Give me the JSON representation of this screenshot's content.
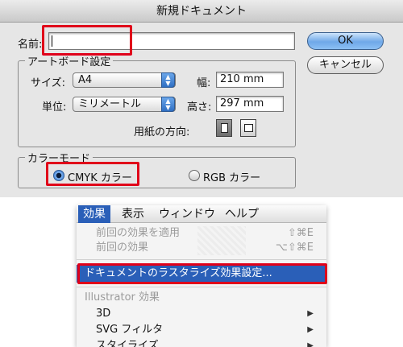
{
  "dialog": {
    "title": "新規ドキュメント",
    "name_label": "名前:",
    "name_value": "",
    "ok_label": "OK",
    "cancel_label": "キャンセル",
    "artboard": {
      "legend": "アートボード設定",
      "size_label": "サイズ:",
      "size_value": "A4",
      "width_label": "幅:",
      "width_value": "210 mm",
      "unit_label": "単位:",
      "unit_value": "ミリメートル",
      "height_label": "高さ:",
      "height_value": "297 mm",
      "orientation_label": "用紙の方向:"
    },
    "color_mode": {
      "legend": "カラーモード",
      "cmyk_label": "CMYK カラー",
      "rgb_label": "RGB カラー",
      "selected": "CMYK"
    }
  },
  "menu": {
    "bar": [
      "効果",
      "表示",
      "ウィンドウ",
      "ヘルプ"
    ],
    "items": {
      "apply_last": {
        "label": "前回の効果を適用",
        "shortcut": "⇧⌘E"
      },
      "last_effect": {
        "label": "前回の効果",
        "shortcut": "⌥⇧⌘E"
      },
      "rasterize": {
        "label": "ドキュメントのラスタライズ効果設定..."
      },
      "illustrator_header": {
        "label": "Illustrator 効果"
      },
      "three_d": {
        "label": "3D"
      },
      "svg_filter": {
        "label": "SVG フィルタ"
      },
      "stylize": {
        "label": "スタイライズ"
      }
    }
  },
  "colors": {
    "highlight_box": "#e0001a",
    "menu_selection": "#2a5fb8",
    "ok_button": "#6fa8e8"
  },
  "icons": {
    "popup_arrow": "up-down-arrows-icon",
    "portrait": "portrait-page-icon",
    "landscape": "landscape-page-icon",
    "submenu": "triangle-right-icon"
  }
}
